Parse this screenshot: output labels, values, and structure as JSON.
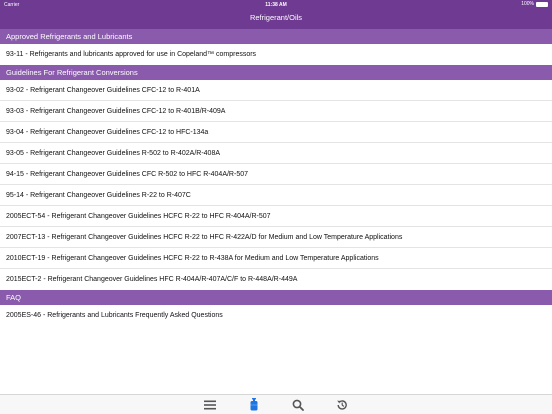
{
  "status": {
    "carrier": "Carrier",
    "time": "11:38 AM",
    "battery": "100%"
  },
  "nav": {
    "title": "Refrigerant/Oils"
  },
  "sections": [
    {
      "header": "Approved Refrigerants and Lubricants",
      "items": [
        "93-11 - Refrigerants and lubricants approved for use in Copeland™ compressors"
      ]
    },
    {
      "header": "Guidelines For Refrigerant Conversions",
      "items": [
        "93-02 - Refrigerant Changeover Guidelines CFC-12 to R-401A",
        "93-03 - Refrigerant Changeover Guidelines CFC-12 to R-401B/R-409A",
        "93-04 - Refrigerant Changeover Guidelines CFC-12 to HFC-134a",
        "93-05 - Refrigerant Changeover Guidelines R-502 to R-402A/R-408A",
        "94-15 - Refrigerant Changeover Guidelines CFC R-502 to HFC R-404A/R-507",
        "95-14 - Refrigerant Changeover Guidelines R-22 to R-407C",
        "2005ECT-54 - Refrigerant Changeover Guidelines HCFC R-22 to HFC R-404A/R-507",
        "2007ECT-13 - Refrigerant Changeover Guidelines HCFC R-22 to HFC R-422A/D for Medium and Low Temperature Applications",
        "2010ECT-19 - Refrigerant Changeover Guidelines HCFC R-22 to R-438A for Medium and Low Temperature Applications",
        "2015ECT-2 - Refrigerant Changeover Guidelines HFC R-404A/R-407A/C/F to R-448A/R-449A"
      ]
    },
    {
      "header": "FAQ",
      "items": [
        "2005ES-46 - Refrigerants and Lubricants Frequently Asked Questions"
      ]
    }
  ],
  "tabbar": {
    "tabs": [
      {
        "icon": "menu-icon",
        "active": false
      },
      {
        "icon": "refrigerant-cylinder-icon",
        "active": true
      },
      {
        "icon": "search-icon",
        "active": false
      },
      {
        "icon": "history-icon",
        "active": false
      }
    ]
  },
  "colors": {
    "nav_bar": "#6f3a92",
    "section_header": "#8a5aad",
    "tab_icon": "#555555",
    "tab_active": "#1e74e0"
  }
}
